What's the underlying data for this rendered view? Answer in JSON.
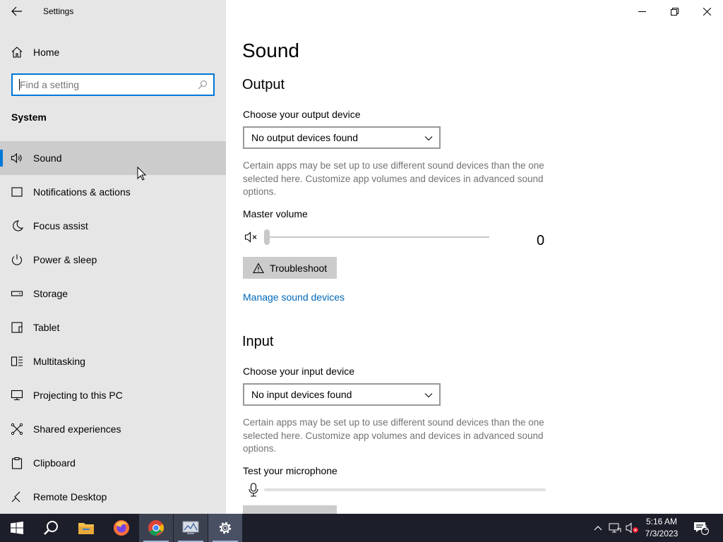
{
  "window": {
    "title": "Settings"
  },
  "sidebar": {
    "home_label": "Home",
    "search_placeholder": "Find a setting",
    "section": "System",
    "items": [
      {
        "label": "Sound",
        "icon": "speaker-icon",
        "selected": true
      },
      {
        "label": "Notifications & actions",
        "icon": "notification-icon"
      },
      {
        "label": "Focus assist",
        "icon": "moon-icon"
      },
      {
        "label": "Power & sleep",
        "icon": "power-icon"
      },
      {
        "label": "Storage",
        "icon": "storage-icon"
      },
      {
        "label": "Tablet",
        "icon": "tablet-icon"
      },
      {
        "label": "Multitasking",
        "icon": "multitasking-icon"
      },
      {
        "label": "Projecting to this PC",
        "icon": "projecting-icon"
      },
      {
        "label": "Shared experiences",
        "icon": "shared-experiences-icon"
      },
      {
        "label": "Clipboard",
        "icon": "clipboard-icon"
      },
      {
        "label": "Remote Desktop",
        "icon": "remote-desktop-icon"
      }
    ]
  },
  "main": {
    "page_title": "Sound",
    "output": {
      "heading": "Output",
      "device_label": "Choose your output device",
      "device_value": "No output devices found",
      "description": "Certain apps may be set up to use different sound devices than the one selected here. Customize app volumes and devices in advanced sound options.",
      "volume_label": "Master volume",
      "volume_value": "0",
      "volume_level": 0,
      "troubleshoot_label": "Troubleshoot",
      "manage_link": "Manage sound devices"
    },
    "input": {
      "heading": "Input",
      "device_label": "Choose your input device",
      "device_value": "No input devices found",
      "description": "Certain apps may be set up to use different sound devices than the one selected here. Customize app volumes and devices in advanced sound options.",
      "test_label": "Test your microphone",
      "mic_level": 0
    }
  },
  "taskbar": {
    "apps": [
      "start-icon",
      "search-icon",
      "file-explorer-icon",
      "firefox-icon",
      "chrome-icon",
      "network-app-icon",
      "settings-icon"
    ],
    "time": "5:16 AM",
    "date": "7/3/2023",
    "notification_count": "1"
  },
  "colors": {
    "accent": "#0078d7",
    "link": "#0067b8",
    "sidebar_bg": "#e6e6e6",
    "taskbar_bg": "#1c1e2a"
  }
}
